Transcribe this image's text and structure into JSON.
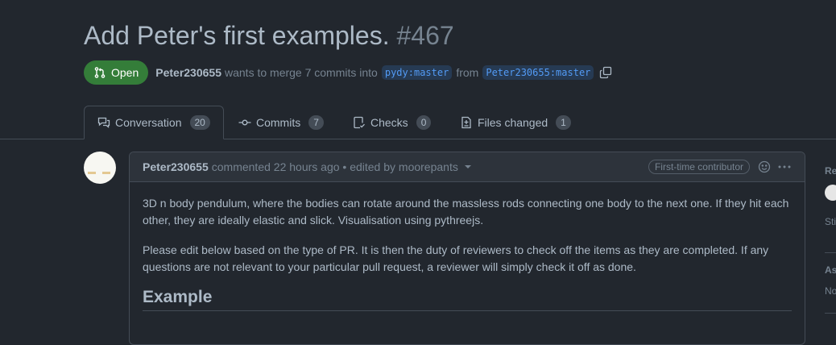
{
  "pr": {
    "title": "Add Peter's first examples.",
    "number": "#467",
    "state_label": "Open",
    "author": "Peter230655",
    "merge_text": "wants to merge 7 commits into",
    "base_branch": "pydy:master",
    "from_text": "from",
    "head_branch": "Peter230655:master"
  },
  "tabs": [
    {
      "label": "Conversation",
      "count": "20",
      "icon": "comment-discussion-icon"
    },
    {
      "label": "Commits",
      "count": "7",
      "icon": "git-commit-icon"
    },
    {
      "label": "Checks",
      "count": "0",
      "icon": "checklist-icon"
    },
    {
      "label": "Files changed",
      "count": "1",
      "icon": "file-diff-icon"
    }
  ],
  "comment": {
    "author": "Peter230655",
    "meta": "commented 22 hours ago • edited by moorepants",
    "badge": "First-time contributor",
    "paragraph1": "3D n body pendulum, where the bodies can rotate around the massless rods connecting one body to the next one. If they hit each other, they are ideally elastic and slick. Visualisation using pythreejs.",
    "paragraph2": "Please edit below based on the type of PR. It is then the duty of reviewers to check off the items as they are completed. If any questions are not relevant to your particular pull request, a reviewer will simply check it off as done.",
    "heading": "Example"
  },
  "sidebar": {
    "reviewers_label": "Re",
    "status_text": "Sti",
    "assignees_label": "As",
    "assignees_value": "No"
  },
  "colors": {
    "background": "#22272e",
    "open_state": "#347d39",
    "branch_bg": "#263a53",
    "branch_fg": "#539bf5"
  }
}
